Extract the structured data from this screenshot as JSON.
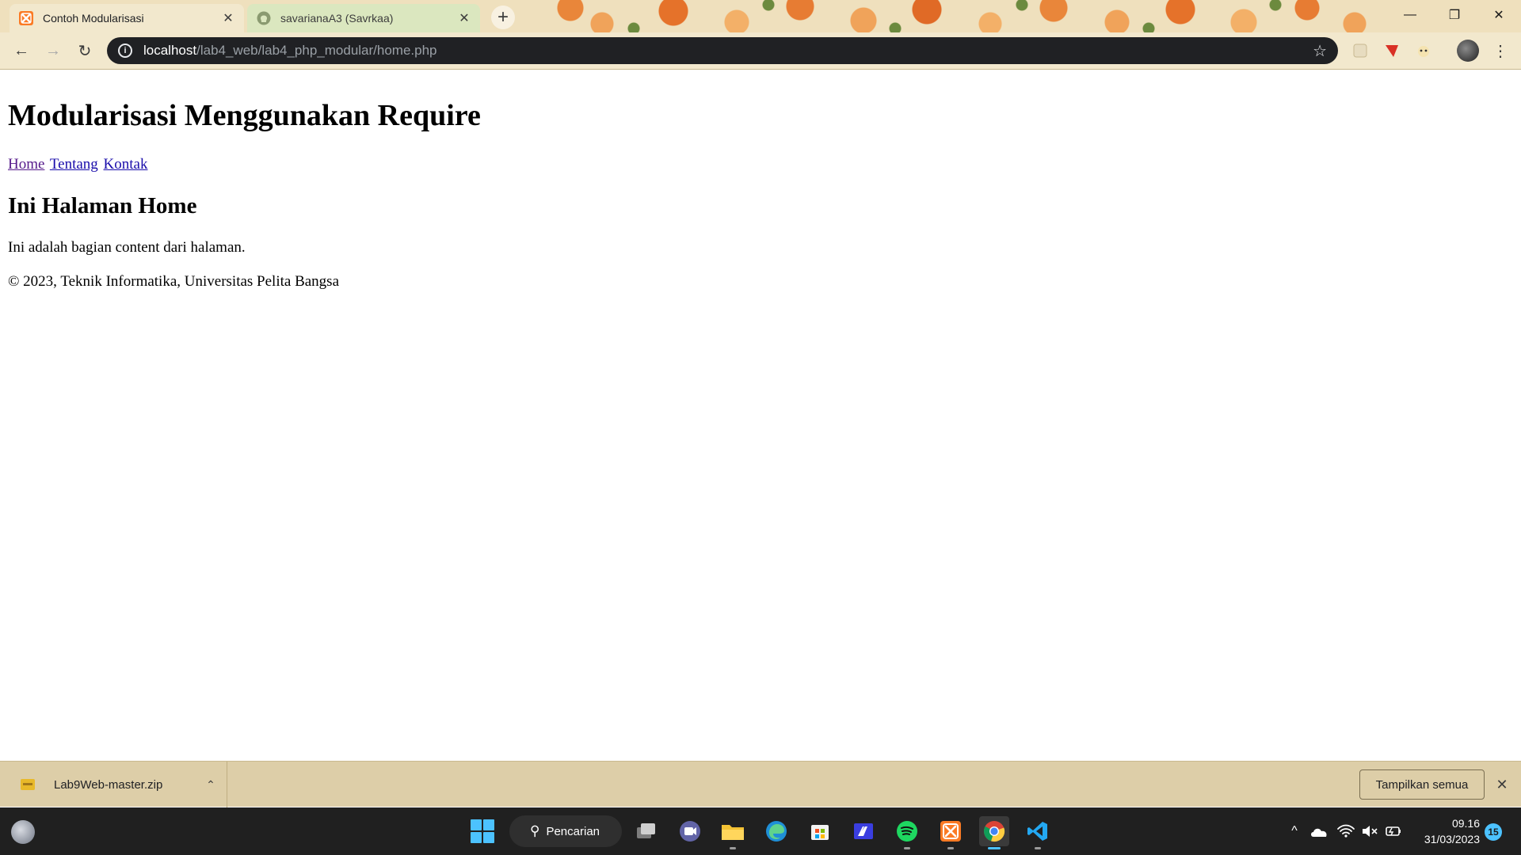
{
  "browser": {
    "tabs": [
      {
        "title": "Contoh Modularisasi",
        "favicon": "xampp-icon",
        "active": true
      },
      {
        "title": "savarianaA3 (Savrkaa)",
        "favicon": "github-icon",
        "active": false
      }
    ],
    "new_tab": "+",
    "window_controls": {
      "minimize": "—",
      "restore": "❐",
      "close": "✕"
    },
    "address": {
      "host": "localhost",
      "path": "/lab4_web/lab4_php_modular/home.php"
    },
    "nav_icons": {
      "back": "←",
      "forward": "→",
      "reload": "↻",
      "info": "i",
      "star": "☆",
      "menu": "⋮"
    }
  },
  "page": {
    "heading": "Modularisasi Menggunakan Require",
    "nav_links": [
      "Home",
      "Tentang",
      "Kontak"
    ],
    "subheading": "Ini Halaman Home",
    "content": "Ini adalah bagian content dari halaman.",
    "footer": "© 2023, Teknik Informatika, Universitas Pelita Bangsa"
  },
  "downloads": {
    "file_name": "Lab9Web-master.zip",
    "chevron": "⌃",
    "show_all": "Tampilkan semua",
    "close": "✕"
  },
  "taskbar": {
    "search_label": "Pencarian",
    "search_icon": "⚲",
    "apps": [
      "file-explorer-window",
      "teams",
      "file-explorer",
      "edge",
      "microsoft-store",
      "ms-app",
      "spotify",
      "xampp",
      "chrome",
      "vscode"
    ],
    "tray": {
      "chevron": "^",
      "wifi": "wifi",
      "volume": "🔇"
    },
    "time": "09.16",
    "date": "31/03/2023",
    "notifications": "15"
  },
  "colors": {
    "accent": "#4cc2ff",
    "omnibox_bg": "#202124",
    "toolbar_bg": "#f2e8cd",
    "shelf_bg": "#ddcea8",
    "link": "#1a0dab",
    "link_visited": "#551a8b"
  }
}
